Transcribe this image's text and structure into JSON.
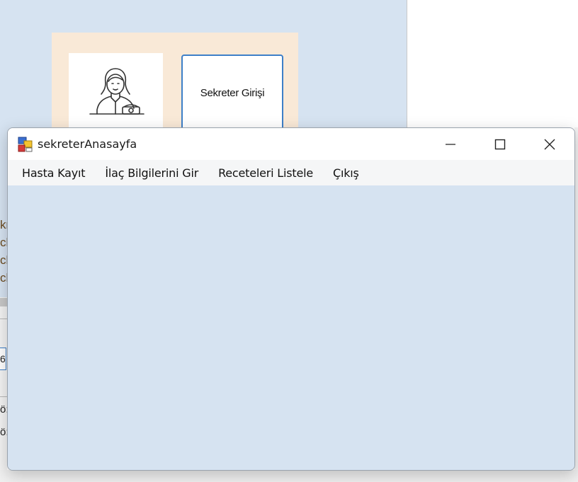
{
  "background_window": {
    "button_label": "Sekreter Girişi",
    "fragments": [
      "kr",
      "ch",
      "ch",
      "ch",
      "6",
      "ö:",
      "ö:"
    ]
  },
  "window": {
    "title": "sekreterAnasayfa",
    "controls": {
      "minimize": "minimize-icon",
      "maximize": "maximize-icon",
      "close": "close-icon"
    }
  },
  "menu": {
    "items": [
      {
        "label": "Hasta Kayıt"
      },
      {
        "label": "İlaç Bilgilerini Gir"
      },
      {
        "label": "Receteleri Listele"
      },
      {
        "label": "Çıkış"
      }
    ]
  },
  "colors": {
    "form_background": "#d6e3f1",
    "panel_background": "#f9e9d7",
    "button_border": "#3d7fc8"
  }
}
